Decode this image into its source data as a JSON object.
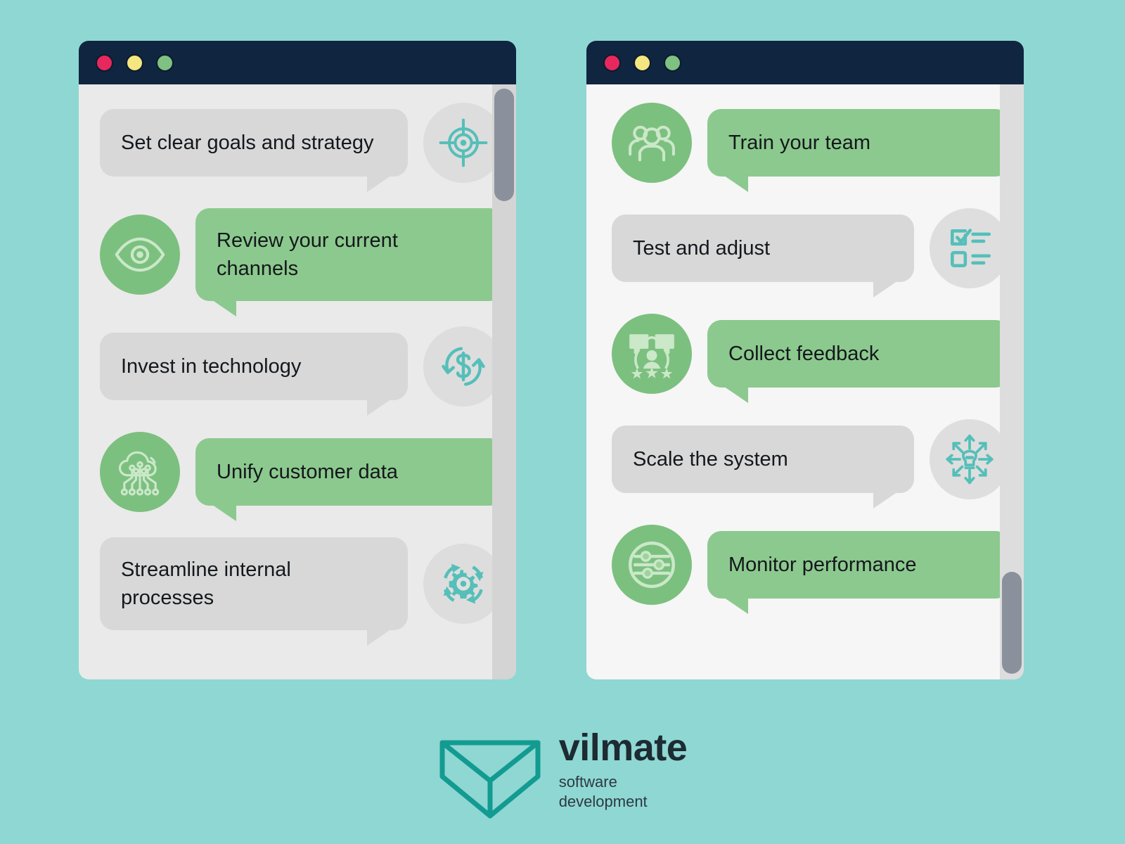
{
  "background_color": "#8fd7d3",
  "windows": [
    {
      "name": "left-window",
      "titlebar": {
        "color": "#10253f",
        "dots": [
          {
            "name": "close-dot",
            "color": "#e7285f"
          },
          {
            "name": "minimize-dot",
            "color": "#f5e77f"
          },
          {
            "name": "maximize-dot",
            "color": "#7fc183"
          }
        ]
      },
      "scrollbar": {
        "track_color": "#d4d4d4",
        "thumb_color": "#8a919c",
        "thumb_position": "top"
      },
      "messages": [
        {
          "text": "Set clear goals and strategy",
          "side": "incoming",
          "bubble_color": "#d8d8d8",
          "avatar_color": "#dddddd",
          "icon": "target-crosshair-icon",
          "icon_color": "#55bfb9"
        },
        {
          "text": "Review your current channels",
          "side": "outgoing",
          "bubble_color": "#8cc98e",
          "avatar_color": "#7cc07f",
          "icon": "eye-icon",
          "icon_color": "#cbe8c9"
        },
        {
          "text": "Invest in technology",
          "side": "incoming",
          "bubble_color": "#d8d8d8",
          "avatar_color": "#dddddd",
          "icon": "dollar-cycle-icon",
          "icon_color": "#55bfb9"
        },
        {
          "text": "Unify customer data",
          "side": "outgoing",
          "bubble_color": "#8cc98e",
          "avatar_color": "#7cc07f",
          "icon": "cloud-network-icon",
          "icon_color": "#cbe8c9"
        },
        {
          "text": "Streamline internal processes",
          "side": "incoming",
          "bubble_color": "#d8d8d8",
          "avatar_color": "#dddddd",
          "icon": "gear-refresh-icon",
          "icon_color": "#55bfb9"
        }
      ]
    },
    {
      "name": "right-window",
      "titlebar": {
        "color": "#10253f",
        "dots": [
          {
            "name": "close-dot",
            "color": "#e7285f"
          },
          {
            "name": "minimize-dot",
            "color": "#f5e77f"
          },
          {
            "name": "maximize-dot",
            "color": "#7fc183"
          }
        ]
      },
      "scrollbar": {
        "track_color": "#dddddd",
        "thumb_color": "#8a919c",
        "thumb_position": "bottom"
      },
      "messages": [
        {
          "text": "Train your team",
          "side": "outgoing",
          "bubble_color": "#8cc98e",
          "avatar_color": "#7cc07f",
          "icon": "people-group-icon",
          "icon_color": "#cbe8c9"
        },
        {
          "text": "Test and adjust",
          "side": "incoming",
          "bubble_color": "#d8d8d8",
          "avatar_color": "#dedede",
          "icon": "checklist-icon",
          "icon_color": "#55bfb9"
        },
        {
          "text": "Collect feedback",
          "side": "outgoing",
          "bubble_color": "#8cc98e",
          "avatar_color": "#7cc07f",
          "icon": "feedback-review-icon",
          "icon_color": "#cbe8c9"
        },
        {
          "text": "Scale the system",
          "side": "incoming",
          "bubble_color": "#d8d8d8",
          "avatar_color": "#dedede",
          "icon": "lightbulb-expand-icon",
          "icon_color": "#55bfb9"
        },
        {
          "text": "Monitor performance",
          "side": "outgoing",
          "bubble_color": "#8cc98e",
          "avatar_color": "#7cc07f",
          "icon": "sliders-icon",
          "icon_color": "#cbe8c9"
        }
      ]
    }
  ],
  "brand": {
    "logo_icon": "vilmate-chevron-box-logo",
    "logo_color": "#129b91",
    "name": "vilmate",
    "tagline_line1": "software",
    "tagline_line2": "development"
  }
}
